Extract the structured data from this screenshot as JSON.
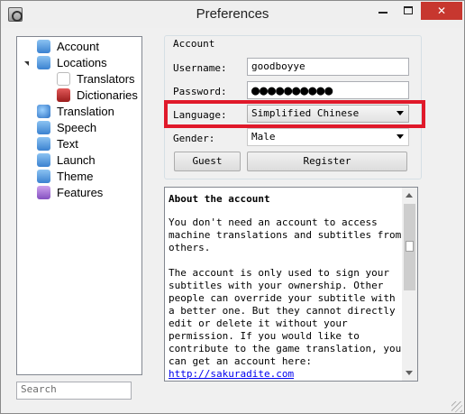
{
  "window": {
    "title": "Preferences",
    "icon": "app-icon",
    "controls": {
      "minimize": "minimize-icon",
      "maximize": "maximize-icon",
      "close": "✕"
    }
  },
  "sidebar": {
    "items": [
      {
        "label": "Account",
        "icon": "user-icon",
        "color": "#3b82d0"
      },
      {
        "label": "Locations",
        "icon": "building-icon",
        "color": "#3b82d0"
      },
      {
        "label": "Translators",
        "icon": "pen-icon",
        "color": "#bbbbbb"
      },
      {
        "label": "Dictionaries",
        "icon": "dictionary-icon",
        "color": "#9b1c1c"
      },
      {
        "label": "Translation",
        "icon": "globe-icon",
        "color": "#2a6fc2"
      },
      {
        "label": "Speech",
        "icon": "music-icon",
        "color": "#3b82d0"
      },
      {
        "label": "Text",
        "icon": "text-icon",
        "color": "#3b82d0"
      },
      {
        "label": "Launch",
        "icon": "launch-icon",
        "color": "#3b82d0"
      },
      {
        "label": "Theme",
        "icon": "theme-icon",
        "color": "#3b82d0"
      },
      {
        "label": "Features",
        "icon": "puzzle-icon",
        "color": "#8450c0"
      }
    ],
    "search_placeholder": "Search"
  },
  "account": {
    "group_title": "Account",
    "username_label": "Username:",
    "username_value": "goodboyye",
    "password_label": "Password:",
    "password_value": "●●●●●●●●●●",
    "language_label": "Language:",
    "language_value": "Simplified Chinese",
    "gender_label": "Gender:",
    "gender_value": "Male",
    "guest_button": "Guest",
    "register_button": "Register"
  },
  "about": {
    "heading": "About the account",
    "para1": "You don't need an account to access machine translations and subtitles from others.",
    "para2": "The account is only used to sign your subtitles with your ownership. Other people can override your subtitle with a better one. But they cannot directly edit or delete it without your permission. If you would like to contribute to the game translation, you can get an account here:",
    "link": "http://sakuradite.com"
  },
  "colors": {
    "highlight": "#e0192a",
    "link": "#0000ee",
    "close_button": "#c7372f"
  }
}
